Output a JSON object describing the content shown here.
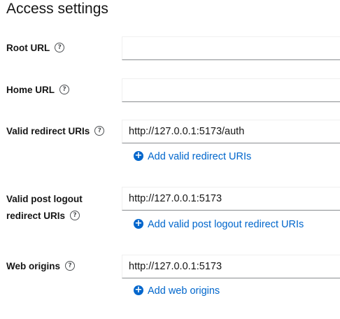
{
  "section": {
    "title": "Access settings"
  },
  "fields": {
    "root_url": {
      "label": "Root URL",
      "value": ""
    },
    "home_url": {
      "label": "Home URL",
      "value": ""
    },
    "valid_redirect_uris": {
      "label": "Valid redirect URIs",
      "value": "http://127.0.0.1:5173/auth",
      "add_label": "Add valid redirect URIs"
    },
    "valid_post_logout_redirect_uris": {
      "label_line1": "Valid post logout",
      "label_line2": "redirect URIs",
      "value": "http://127.0.0.1:5173",
      "add_label": "Add valid post logout redirect URIs"
    },
    "web_origins": {
      "label": "Web origins",
      "value": "http://127.0.0.1:5173",
      "add_label": "Add web origins"
    }
  },
  "icons": {
    "help": "help-circle-icon",
    "add": "plus-circle-icon"
  },
  "colors": {
    "link": "#0066cc",
    "text": "#151515",
    "input_border": "#8a8d90"
  }
}
